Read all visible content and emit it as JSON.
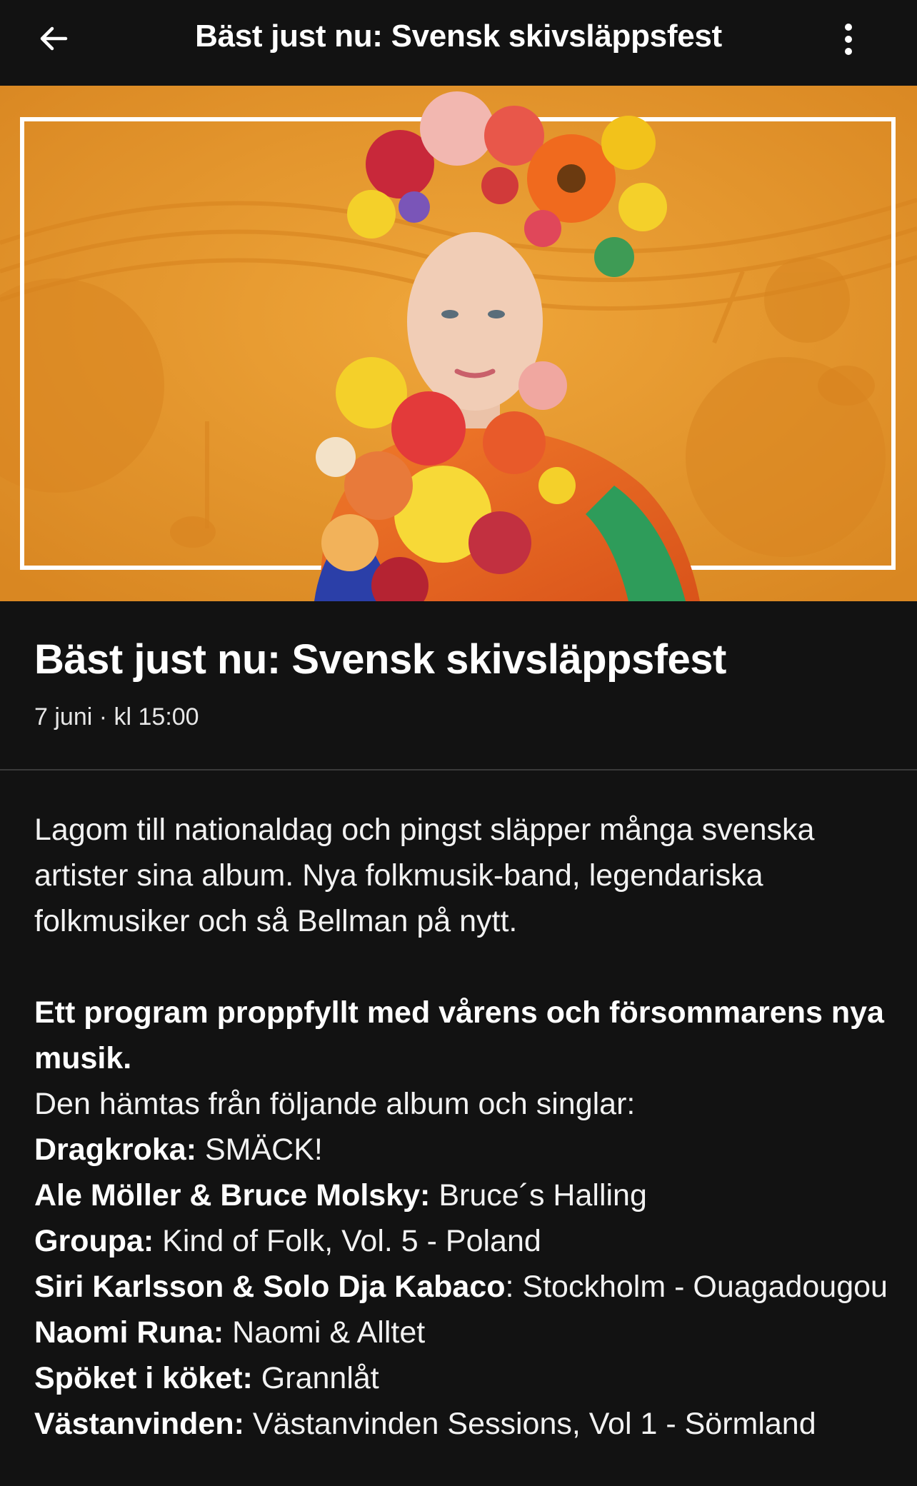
{
  "header": {
    "title": "Bäst just nu: Svensk skivsläppsfest",
    "back_icon": "arrow-left-icon",
    "more_icon": "more-vertical-icon"
  },
  "hero": {
    "image": "Woman with a large crown of colorful flowers in front of an orange background with music notes and a white frame",
    "colors": {
      "background": "#E5972C",
      "frame": "#FFFFFF"
    }
  },
  "event": {
    "title": "Bäst just nu: Svensk skivsläppsfest",
    "date": "7 juni · kl 15:00"
  },
  "description": {
    "intro": "Lagom till nationaldag och pingst släpper många svenska artister sina album. Nya folkmusik-band, legendariska folkmusiker och så Bellman på nytt.",
    "highlight": "Ett program proppfyllt med vårens och försommarens nya musik.",
    "lead": "Den hämtas från följande album och singlar:",
    "tracks": [
      {
        "artist": "Dragkroka:",
        "album": " SMÄCK!"
      },
      {
        "artist": "Ale Möller & Bruce Molsky:",
        "album": " Bruce´s Halling"
      },
      {
        "artist": "Groupa:",
        "album": " Kind of Folk, Vol. 5 - Poland"
      },
      {
        "artist": "Siri Karlsson & Solo Dja Kabaco",
        "album": ": Stockholm - Ouagadougou"
      },
      {
        "artist": "Naomi Runa:",
        "album": " Naomi & Alltet"
      },
      {
        "artist": "Spöket i köket:",
        "album": " Grannlåt"
      },
      {
        "artist": "Västanvinden:",
        "album": " Västanvinden Sessions, Vol 1 - Sörmland"
      }
    ]
  },
  "theme": {
    "background": "#121212",
    "text": "#FFFFFF",
    "divider": "#3A3A3A"
  }
}
